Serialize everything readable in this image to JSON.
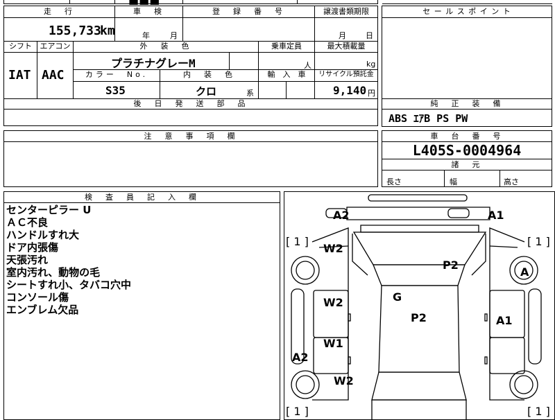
{
  "top_strip": {
    "cut_text": "■■■"
  },
  "mileage": {
    "header": "走　行",
    "value": "155,733",
    "unit": "km"
  },
  "shaken": {
    "header": "車　検",
    "year_unit": "年",
    "month_unit": "月"
  },
  "registration": {
    "header": "登　録　番　号",
    "value": ""
  },
  "transfer_deadline": {
    "header": "譲渡書類期限",
    "month_unit": "月",
    "day_unit": "日"
  },
  "shift": {
    "header": "シフト",
    "value": "IAT"
  },
  "aircon": {
    "header": "エアコン",
    "value": "AAC"
  },
  "exterior_color": {
    "header": "外　装　色",
    "value": "プラチナグレーM"
  },
  "capacity": {
    "header": "乗車定員",
    "unit": "人"
  },
  "max_load": {
    "header": "最大積載量",
    "unit": "kg"
  },
  "color_no": {
    "header": "カラー　No.",
    "value": "S35"
  },
  "interior_color": {
    "header": "内　装　色",
    "value": "クロ",
    "suffix": "系"
  },
  "import_car": {
    "header": "輸　入　車"
  },
  "recycle_fee": {
    "header": "リサイクル預託金",
    "value": "9,140",
    "unit": "円"
  },
  "deferred_parts": {
    "header": "後　日　発　送　部　品",
    "value": ""
  },
  "sales_point": {
    "header": "セ ー ル ス ポ イ ン ト",
    "value": ""
  },
  "standard_equipment": {
    "header": "純　正　装　備",
    "value": "ABS  ｴｱB  PS  PW"
  },
  "caution": {
    "header": "注　意　事　項　欄",
    "value": ""
  },
  "chassis_number": {
    "header": "車　台　番　号",
    "value": "L405S-0004964"
  },
  "specs": {
    "header": "諸　元",
    "length_label": "長さ",
    "width_label": "幅",
    "height_label": "高さ"
  },
  "inspector_notes": {
    "header": "検　査　員　記　入　欄",
    "lines": [
      "センターピラー U",
      "ＡＣ不良",
      "ハンドルすれ大",
      "ドア内張傷",
      "天張汚れ",
      "室内汚れ、動物の毛",
      "シートすれ小、タバコ穴中",
      "コンソール傷",
      "エンブレム欠品"
    ]
  },
  "diagram": {
    "marks": {
      "a2_top": "A2",
      "a1_top": "A1",
      "bracket_left": "[ 1 ]",
      "bracket_right": "[ 1 ]",
      "w2_front": "W2",
      "p2_front": "P2",
      "a_right": "A",
      "g_center": "G",
      "w2_mid": "W2",
      "p2_center": "P2",
      "a1_right": "A1",
      "w1": "W1",
      "a2_left": "A2",
      "w2_rear": "W2",
      "bracket_left_bottom": "[ 1 ]",
      "bracket_right_bottom": "[ 1 ]"
    }
  }
}
